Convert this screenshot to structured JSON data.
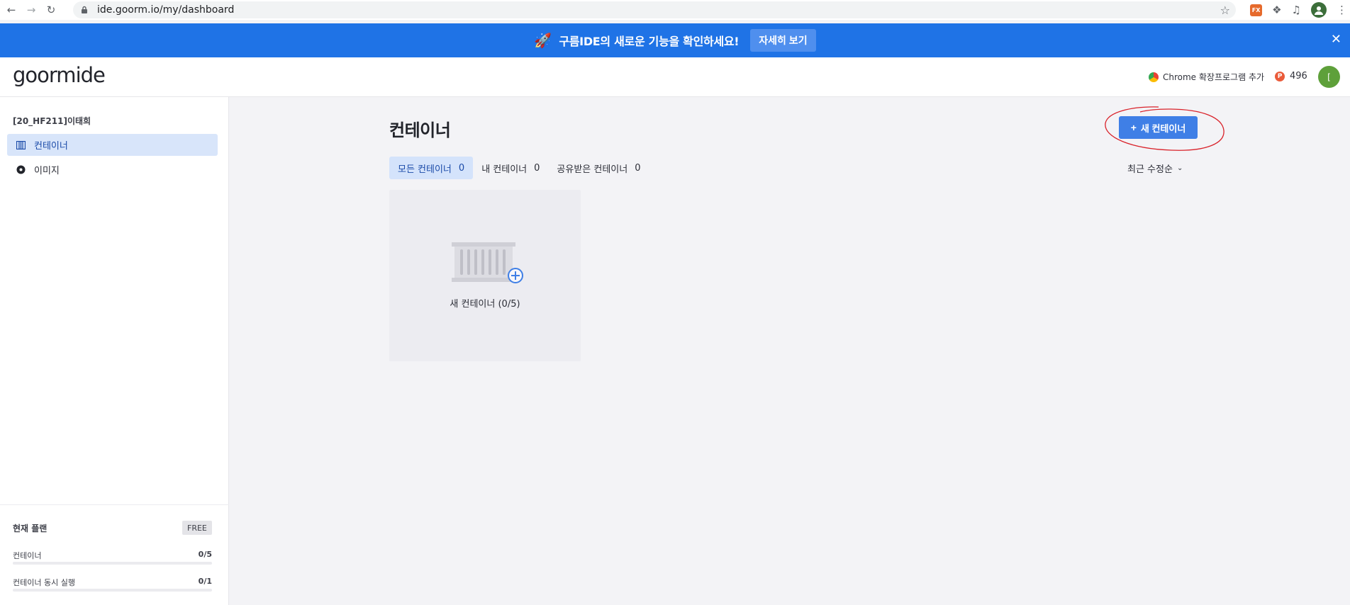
{
  "browser": {
    "url": "ide.goorm.io/my/dashboard",
    "ext_fx_label": "FX"
  },
  "announcement": {
    "message": "구름IDE의 새로운 기능을 확인하세요!",
    "button_label": "자세히 보기"
  },
  "header": {
    "logo_goorm": "goorm",
    "logo_ide": "ide",
    "chrome_ext_label": "Chrome 확장프로그램 추가",
    "points_icon": "P",
    "points_value": "496",
    "avatar_initial": "[",
    "accent_color": "#1f73e6"
  },
  "sidebar": {
    "org_name": "[20_HF211]이태희",
    "items": [
      {
        "label": "컨테이너",
        "icon": "container-icon",
        "active": true
      },
      {
        "label": "이미지",
        "icon": "image-disc-icon",
        "active": false
      }
    ],
    "plan": {
      "title": "현재 플랜",
      "badge": "FREE",
      "rows": [
        {
          "label": "컨테이너",
          "value": "0/5",
          "fraction": 0
        },
        {
          "label": "컨테이너 동시 실행",
          "value": "0/1",
          "fraction": 0
        }
      ]
    }
  },
  "main": {
    "title": "컨테이너",
    "new_button_label": "새 컨테이너",
    "tabs": [
      {
        "label": "모든 컨테이너",
        "count": "0",
        "active": true
      },
      {
        "label": "내 컨테이너",
        "count": "0",
        "active": false
      },
      {
        "label": "공유받은 컨테이너",
        "count": "0",
        "active": false
      }
    ],
    "sort_label": "최근 수정순",
    "new_card_label": "새 컨테이너 (0/5)"
  }
}
